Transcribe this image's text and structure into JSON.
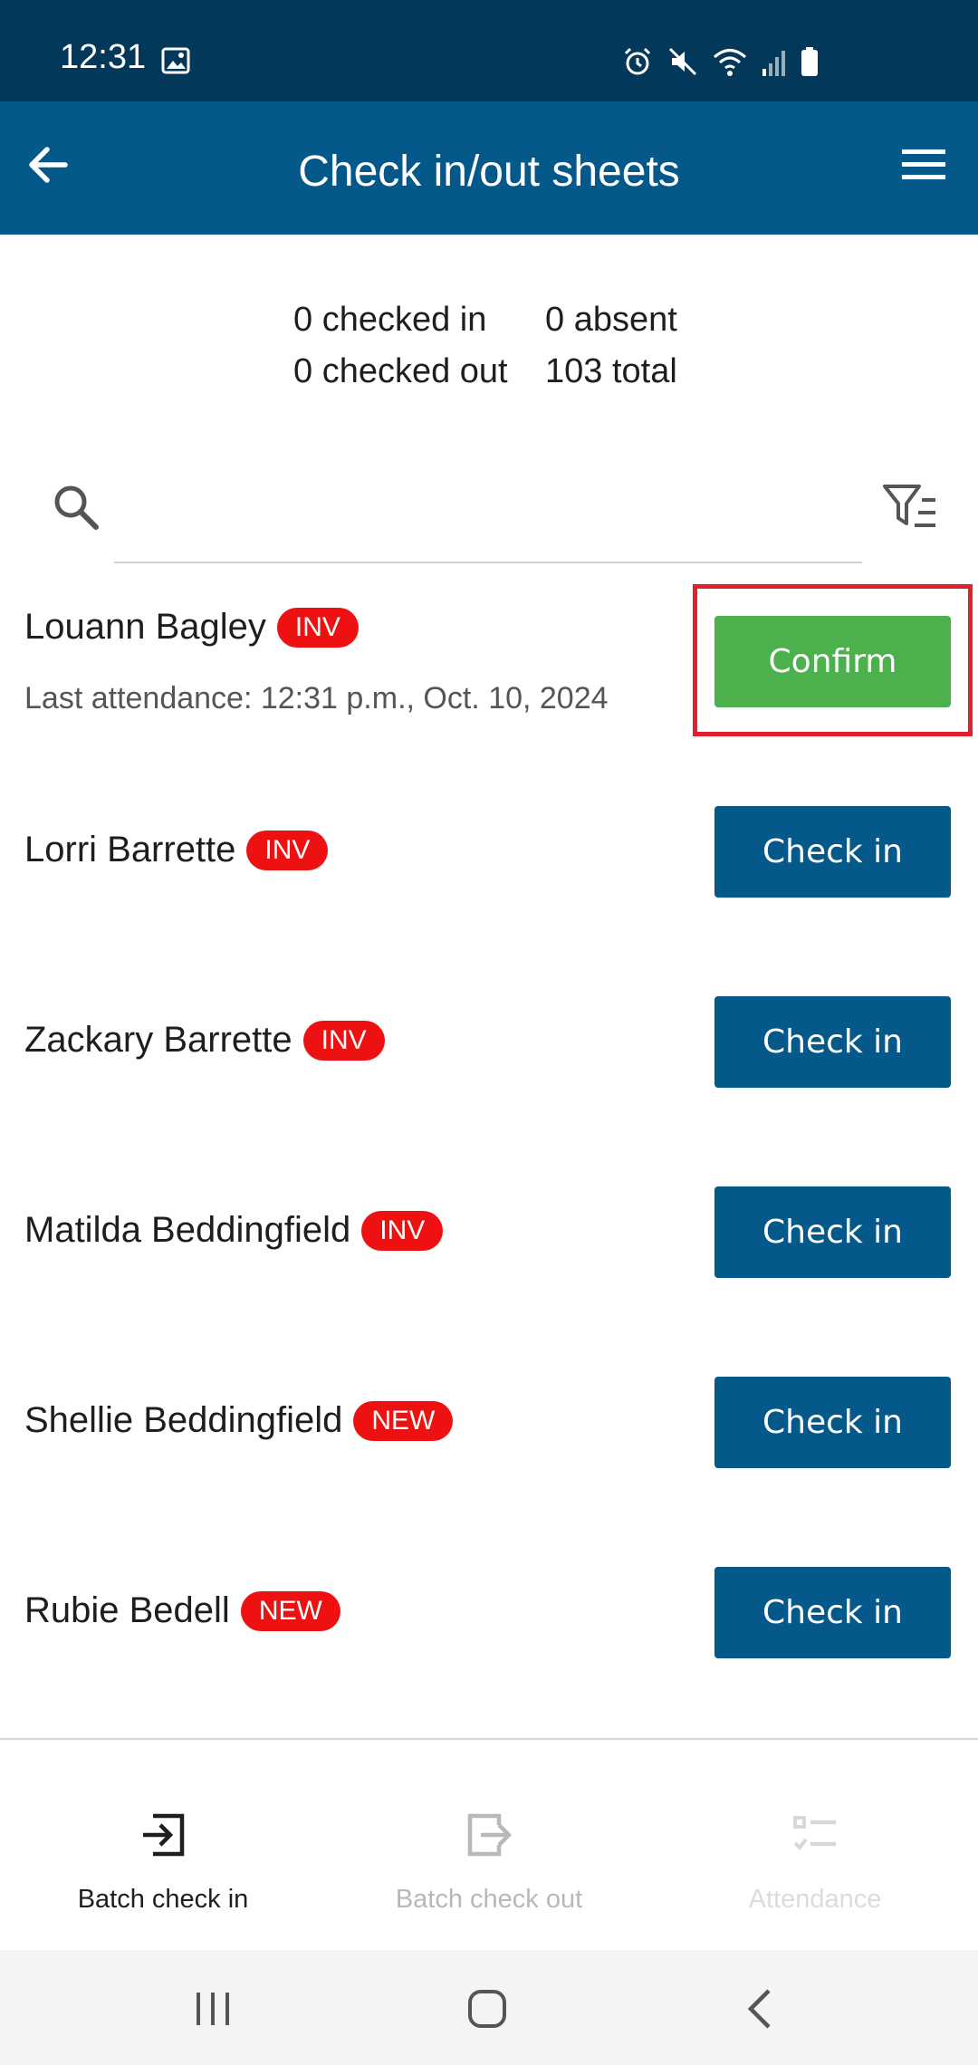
{
  "status_bar": {
    "time": "12:31",
    "icons": [
      "gallery-icon",
      "alarm-icon",
      "mute-icon",
      "wifi-icon",
      "signal-icon",
      "battery-icon"
    ]
  },
  "app_bar": {
    "title": "Check in/out sheets",
    "back_icon": "arrow-left-icon",
    "menu_icon": "hamburger-menu-icon"
  },
  "stats": {
    "checked_in": "0 checked in",
    "absent": "0 absent",
    "checked_out": "0 checked out",
    "total": "103 total"
  },
  "search": {
    "placeholder": "",
    "value": "",
    "icon": "search-icon",
    "filter_icon": "filter-list-icon"
  },
  "people": [
    {
      "name": "Louann Bagley",
      "badge": "INV",
      "last_attendance": "Last attendance: 12:31 p.m., Oct. 10, 2024",
      "action": "Confirm"
    },
    {
      "name": "Lorri Barrette",
      "badge": "INV",
      "action": "Check in"
    },
    {
      "name": "Zackary Barrette",
      "badge": "INV",
      "action": "Check in"
    },
    {
      "name": "Matilda Beddingfield",
      "badge": "INV",
      "action": "Check in"
    },
    {
      "name": "Shellie Beddingfield",
      "badge": "NEW",
      "action": "Check in"
    },
    {
      "name": "Rubie Bedell",
      "badge": "NEW",
      "action": "Check in"
    }
  ],
  "bottom_nav": [
    {
      "label": "Batch check in",
      "icon": "batch-check-in-icon",
      "active": true
    },
    {
      "label": "Batch check out",
      "icon": "batch-check-out-icon",
      "active": false
    },
    {
      "label": "Attendance",
      "icon": "attendance-list-icon",
      "active": false
    }
  ],
  "colors": {
    "status_bar": "#04385a",
    "app_bar": "#04588a",
    "check_in_button": "#04588a",
    "confirm_button": "#4cb04c",
    "badge": "#ee1111",
    "highlight": "#e0202c",
    "nav_active": "#1e1e1e",
    "nav_inactive": "#b8b8b8",
    "nav_disabled": "#dcdcdc"
  }
}
